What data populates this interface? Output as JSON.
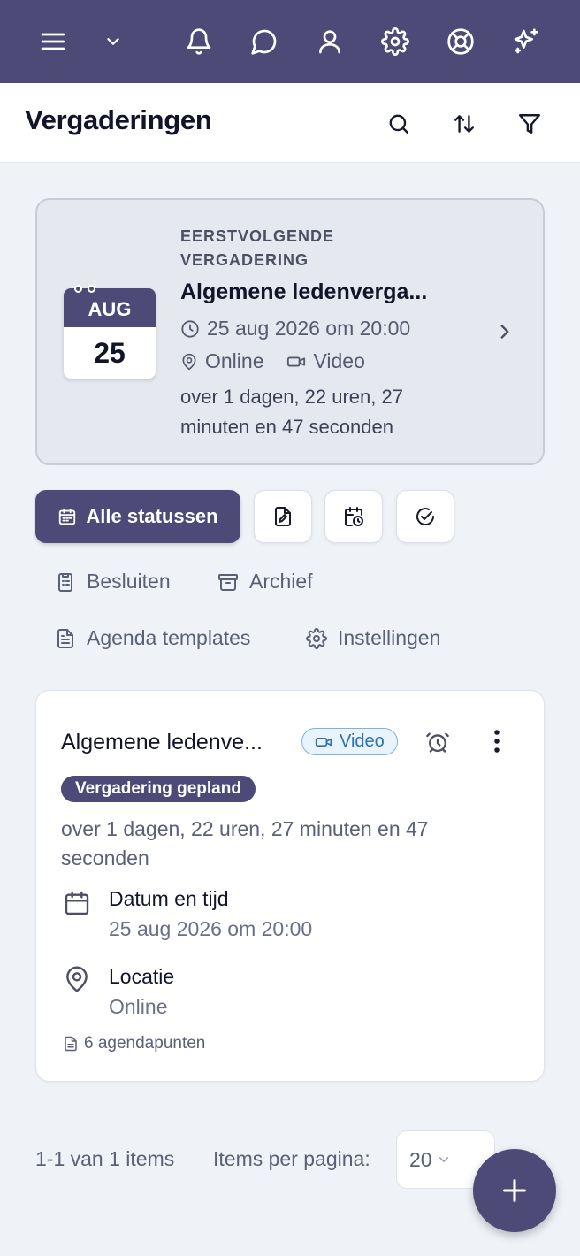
{
  "topbar": {
    "icons": [
      "menu-icon",
      "chevron-down-icon",
      "bell-icon",
      "chat-icon",
      "user-icon",
      "gear-icon",
      "lifebuoy-icon",
      "sparkles-icon"
    ],
    "accent_color": "#4d4a78"
  },
  "header": {
    "title": "Vergaderingen",
    "icons": [
      "search-icon",
      "sort-icon",
      "filter-icon"
    ]
  },
  "next_meeting": {
    "eyebrow": "EERSTVOLGENDE VERGADERING",
    "calendar_month": "AUG",
    "calendar_day": "25",
    "title": "Algemene ledenverga...",
    "datetime": "25 aug 2026 om 20:00",
    "location": "Online",
    "type": "Video",
    "countdown": "over 1 dagen, 22 uren, 27 minuten en 47 seconden"
  },
  "filters": {
    "status_label": "Alle statussen",
    "icon_buttons": [
      "document-edit-icon",
      "calendar-clock-icon",
      "check-circle-icon"
    ]
  },
  "nav_links": {
    "besluiten": "Besluiten",
    "archief": "Archief",
    "agenda_templates": "Agenda templates",
    "instellingen": "Instellingen"
  },
  "meeting_card": {
    "title": "Algemene ledenve...",
    "badge": "Video",
    "status": "Vergadering gepland",
    "countdown": "over 1 dagen, 22 uren, 27 minuten en 47 seconden",
    "datetime_label": "Datum en tijd",
    "datetime_value": "25 aug 2026 om 20:00",
    "location_label": "Locatie",
    "location_value": "Online",
    "agenda_items": "6 agendapunten"
  },
  "pagination": {
    "range": "1-1 van 1 items",
    "per_page_label": "Items per pagina:",
    "per_page_value": "20"
  },
  "fab": {
    "icon": "plus-icon"
  }
}
